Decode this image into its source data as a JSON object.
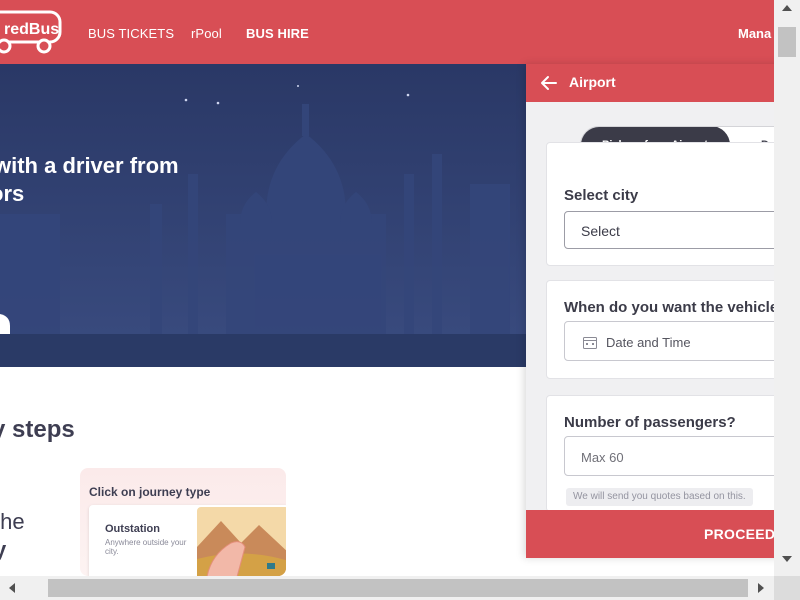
{
  "header": {
    "logo_text": "redBus",
    "nav": {
      "bus_tickets": "BUS TICKETS",
      "rpool": "rPool",
      "bus_hire": "BUS HIRE",
      "manage": "Mana"
    },
    "brand_color": "#d84e55"
  },
  "hero": {
    "title_line1": "with a driver from",
    "title_line2": "ors",
    "background_color": "#2e3e6e"
  },
  "steps": {
    "heading": "y steps",
    "side_line1": "the",
    "side_line2": "y",
    "card": {
      "title": "Click on journey type",
      "option_title": "Outstation",
      "option_desc": "Anywhere outside your city."
    }
  },
  "panel": {
    "back_icon": "arrow-left-icon",
    "title": "Airport",
    "toggle": {
      "pickup_label": "Pick up from Airport",
      "drop_label": "Dro"
    },
    "city": {
      "label": "Select city",
      "value": "Select"
    },
    "when": {
      "label": "When do you want the vehicle",
      "icon": "calendar-icon",
      "placeholder": "Date and Time"
    },
    "passengers": {
      "label": "Number of passengers?",
      "placeholder": "Max 60",
      "note": "We will send you quotes based on this."
    },
    "proceed_label": "PROCEED"
  }
}
